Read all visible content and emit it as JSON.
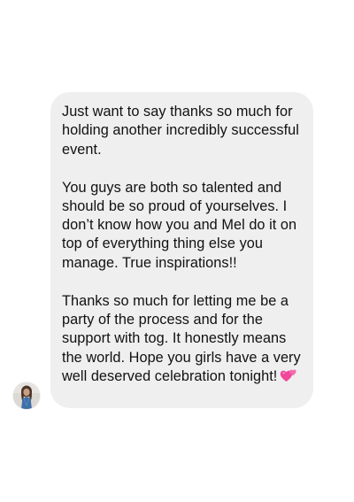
{
  "message": {
    "paragraphs": [
      "Just want to say thanks so much for holding another incredibly successful event.",
      "You guys are both so talented and should be so proud of yourselves. I don’t know how you and Mel do it on top of everything thing else you manage. True inspirations!!",
      "Thanks so much for letting me be a party of the process and for the support with tog. It honestly means the world. Hope you girls have a very well deserved celebration tonight!"
    ],
    "emoji": "two-hearts-icon"
  },
  "colors": {
    "bubble_background": "#efefef",
    "text": "#111111",
    "page_background": "#ffffff",
    "heart": "#f0489a"
  },
  "sender": {
    "avatar": "profile-photo"
  }
}
